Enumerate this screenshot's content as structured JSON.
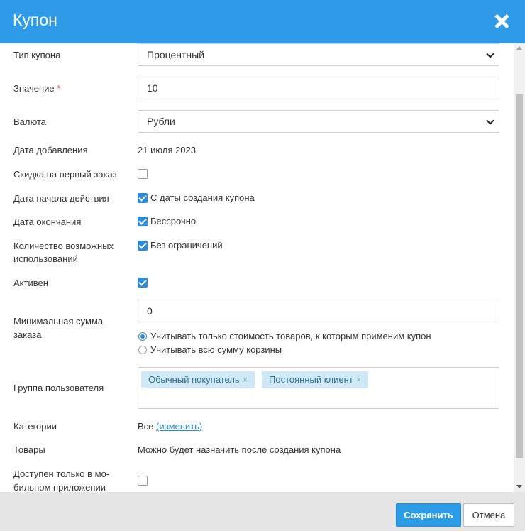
{
  "dialog": {
    "title": "Купон"
  },
  "form": {
    "coupon_type": {
      "label": "Тип купона",
      "value": "Процентный"
    },
    "value": {
      "label": "Значение",
      "required_mark": "*",
      "value": "10"
    },
    "currency": {
      "label": "Валюта",
      "value": "Рубли"
    },
    "date_added": {
      "label": "Дата добавления",
      "value": "21 июля 2023"
    },
    "first_order": {
      "label": "Скидка на первый заказ",
      "checked": false
    },
    "start_date": {
      "label": "Дата начала действия",
      "checked": true,
      "text": "С даты создания купона"
    },
    "end_date": {
      "label": "Дата окончания",
      "checked": true,
      "text": "Бессрочно"
    },
    "usage_count": {
      "label_line1": "Количество возможных",
      "label_line2": "использований",
      "checked": true,
      "text": "Без ограничений"
    },
    "active": {
      "label": "Активен",
      "checked": true
    },
    "min_order": {
      "label_line1": "Минимальная сумма",
      "label_line2": "заказа",
      "value": "0",
      "options": [
        {
          "text": "Учитывать только стоимость товаров, к которым применим купон",
          "selected": true
        },
        {
          "text": "Учитывать всю сумму корзины",
          "selected": false
        }
      ]
    },
    "user_group": {
      "label": "Группа пользователя",
      "tags": [
        "Обычный покупатель",
        "Постоянный клиент"
      ],
      "remove_glyph": "×"
    },
    "categories": {
      "label": "Категории",
      "value": "Все",
      "link": "(изменить)"
    },
    "products": {
      "label": "Товары",
      "value": "Можно будет назначить после создания купона"
    },
    "mobile_only": {
      "label_line1": "Доступен только в мо-",
      "label_line2": "бильном приложении",
      "checked": false
    }
  },
  "footer": {
    "save_label": "Сохранить",
    "cancel_label": "Отмена"
  },
  "colors": {
    "header": "#2f9be8",
    "accent": "#2d8bda",
    "tag_bg": "#cfe9f6",
    "footer_bg": "#e5e5e5"
  }
}
